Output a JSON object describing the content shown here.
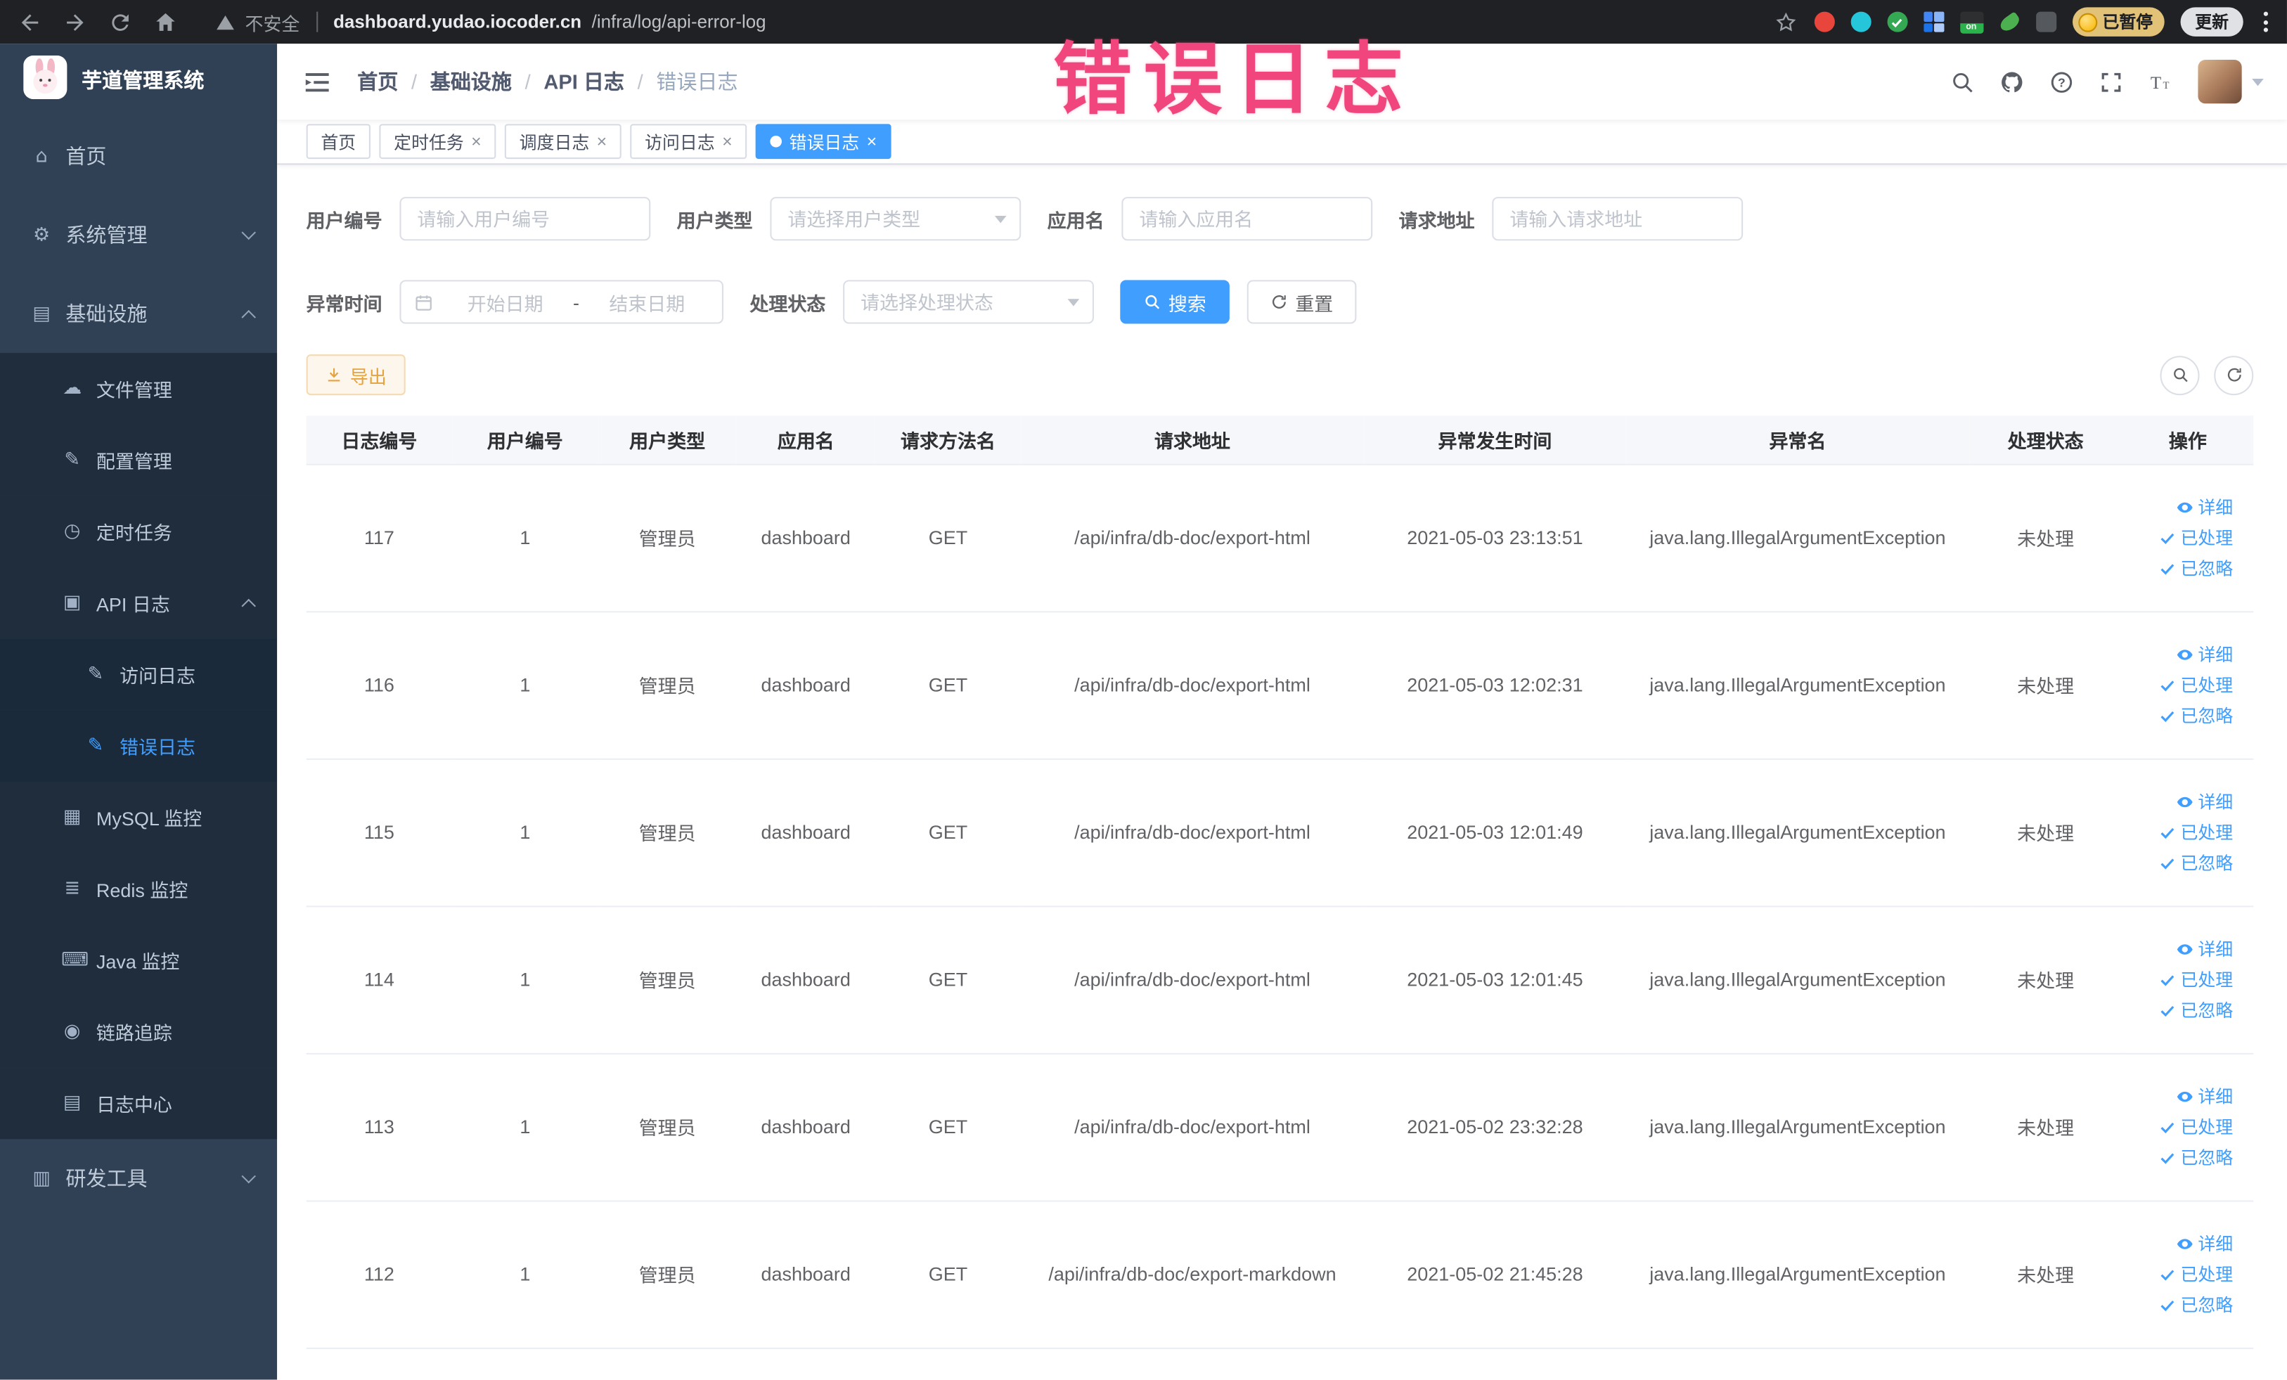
{
  "browser": {
    "security_warning": "不安全",
    "url_domain": "dashboard.yudao.iocoder.cn",
    "url_path": "/infra/log/api-error-log",
    "profile_badge": "已暂停",
    "update_button": "更新",
    "extension_on_badge": "on"
  },
  "annotation": {
    "text": "错误日志"
  },
  "colors": {
    "primary": "#409eff",
    "sidebar_bg": "#304156",
    "sidebar_sub_bg": "#1f2d3d",
    "annotation_pink": "#f0457d",
    "export_warning": "#e6a23c",
    "browser_chrome": "#202124"
  },
  "sidebar": {
    "app_title": "芋道管理系统",
    "items": [
      {
        "label": "首页",
        "icon": "home-icon",
        "glyph": "⌂"
      },
      {
        "label": "系统管理",
        "icon": "gear-icon",
        "glyph": "⚙"
      },
      {
        "label": "基础设施",
        "icon": "infrastructure-icon",
        "glyph": "▤"
      },
      {
        "label": "文件管理",
        "icon": "cloud-file-icon",
        "glyph": "☁"
      },
      {
        "label": "配置管理",
        "icon": "config-edit-icon",
        "glyph": "✎"
      },
      {
        "label": "定时任务",
        "icon": "clock-icon",
        "glyph": "◷"
      },
      {
        "label": "API 日志",
        "icon": "api-log-icon",
        "glyph": "▣"
      },
      {
        "label": "访问日志",
        "icon": "access-log-icon",
        "glyph": "✎"
      },
      {
        "label": "错误日志",
        "icon": "error-log-icon",
        "glyph": "✎"
      },
      {
        "label": "MySQL 监控",
        "icon": "mysql-monitor-icon",
        "glyph": "▦"
      },
      {
        "label": "Redis 监控",
        "icon": "redis-monitor-icon",
        "glyph": "≣"
      },
      {
        "label": "Java 监控",
        "icon": "java-monitor-icon",
        "glyph": "⌨"
      },
      {
        "label": "链路追踪",
        "icon": "trace-icon",
        "glyph": "◉"
      },
      {
        "label": "日志中心",
        "icon": "log-center-icon",
        "glyph": "▤"
      },
      {
        "label": "研发工具",
        "icon": "dev-tools-icon",
        "glyph": "▥"
      }
    ]
  },
  "breadcrumb": {
    "separator": "/",
    "items": [
      "首页",
      "基础设施",
      "API 日志",
      "错误日志"
    ]
  },
  "tabs": [
    {
      "label": "首页"
    },
    {
      "label": "定时任务"
    },
    {
      "label": "调度日志"
    },
    {
      "label": "访问日志"
    },
    {
      "label": "错误日志"
    }
  ],
  "filters": {
    "user_id_label": "用户编号",
    "user_id_placeholder": "请输入用户编号",
    "user_type_label": "用户类型",
    "user_type_placeholder": "请选择用户类型",
    "app_name_label": "应用名",
    "app_name_placeholder": "请输入应用名",
    "request_url_label": "请求地址",
    "request_url_placeholder": "请输入请求地址",
    "exception_time_label": "异常时间",
    "date_start_placeholder": "开始日期",
    "date_separator": "-",
    "date_end_placeholder": "结束日期",
    "process_status_label": "处理状态",
    "process_status_placeholder": "请选择处理状态",
    "search_button": "搜索",
    "reset_button": "重置"
  },
  "toolbar": {
    "export_button": "导出"
  },
  "table": {
    "columns": [
      "日志编号",
      "用户编号",
      "用户类型",
      "应用名",
      "请求方法名",
      "请求地址",
      "异常发生时间",
      "异常名",
      "处理状态",
      "操作"
    ],
    "action_labels": {
      "detail": "详细",
      "processed": "已处理",
      "ignored": "已忽略"
    },
    "rows": [
      {
        "id": "117",
        "user_id": "1",
        "user_type": "管理员",
        "app": "dashboard",
        "method": "GET",
        "url": "/api/infra/db-doc/export-html",
        "time": "2021-05-03 23:13:51",
        "exception": "java.lang.IllegalArgumentException",
        "status": "未处理"
      },
      {
        "id": "116",
        "user_id": "1",
        "user_type": "管理员",
        "app": "dashboard",
        "method": "GET",
        "url": "/api/infra/db-doc/export-html",
        "time": "2021-05-03 12:02:31",
        "exception": "java.lang.IllegalArgumentException",
        "status": "未处理"
      },
      {
        "id": "115",
        "user_id": "1",
        "user_type": "管理员",
        "app": "dashboard",
        "method": "GET",
        "url": "/api/infra/db-doc/export-html",
        "time": "2021-05-03 12:01:49",
        "exception": "java.lang.IllegalArgumentException",
        "status": "未处理"
      },
      {
        "id": "114",
        "user_id": "1",
        "user_type": "管理员",
        "app": "dashboard",
        "method": "GET",
        "url": "/api/infra/db-doc/export-html",
        "time": "2021-05-03 12:01:45",
        "exception": "java.lang.IllegalArgumentException",
        "status": "未处理"
      },
      {
        "id": "113",
        "user_id": "1",
        "user_type": "管理员",
        "app": "dashboard",
        "method": "GET",
        "url": "/api/infra/db-doc/export-html",
        "time": "2021-05-02 23:32:28",
        "exception": "java.lang.IllegalArgumentException",
        "status": "未处理"
      },
      {
        "id": "112",
        "user_id": "1",
        "user_type": "管理员",
        "app": "dashboard",
        "method": "GET",
        "url": "/api/infra/db-doc/export-markdown",
        "time": "2021-05-02 21:45:28",
        "exception": "java.lang.IllegalArgumentException",
        "status": "未处理"
      }
    ]
  }
}
